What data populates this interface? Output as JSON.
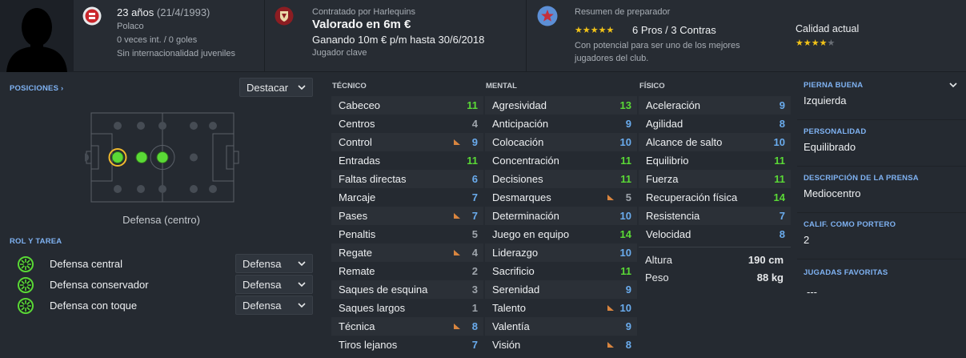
{
  "header": {
    "age_label": "23 años",
    "dob": "(21/4/1993)",
    "nationality": "Polaco",
    "caps": "0 veces int. / 0 goles",
    "youth_caps": "Sin internacionalidad juveniles",
    "contract_caption": "Contratado por Harlequins",
    "valuation": "Valorado en 6m €",
    "wage": "Ganando 10m € p/m hasta 30/6/2018",
    "squad_status": "Jugador clave",
    "coach_report_title": "Resumen de preparador",
    "pros_cons": "6 Pros / 3 Contras",
    "potential_text_line1": "Con potencial para ser uno de los mejores",
    "potential_text_line2": "jugadores del club.",
    "current_ability_label": "Calidad actual",
    "potential_stars": 5,
    "current_ability_stars": 4,
    "star_color": "#f2c318",
    "club_badge_color": "#c9262b",
    "icons": [
      "player-silhouette-icon",
      "nationality-badge-icon",
      "club-crest-icon",
      "coach-star-icon"
    ]
  },
  "positions": {
    "title": "POSICIONES ›",
    "highlight_dropdown": "Destacar",
    "position_name": "Defensa (centro)"
  },
  "roles": {
    "title": "ROL Y TAREA",
    "items": [
      {
        "name": "Defensa central",
        "duty": "Defensa"
      },
      {
        "name": "Defensa conservador",
        "duty": "Defensa"
      },
      {
        "name": "Defensa con toque",
        "duty": "Defensa"
      }
    ]
  },
  "technical": {
    "title": "TÉCNICO",
    "attributes": [
      {
        "name": "Cabeceo",
        "value": "11"
      },
      {
        "name": "Centros",
        "value": "4"
      },
      {
        "name": "Control",
        "value": "9",
        "flag": "down"
      },
      {
        "name": "Entradas",
        "value": "11"
      },
      {
        "name": "Faltas directas",
        "value": "6"
      },
      {
        "name": "Marcaje",
        "value": "7"
      },
      {
        "name": "Pases",
        "value": "7",
        "flag": "down"
      },
      {
        "name": "Penaltis",
        "value": "5"
      },
      {
        "name": "Regate",
        "value": "4",
        "flag": "down"
      },
      {
        "name": "Remate",
        "value": "2"
      },
      {
        "name": "Saques de esquina",
        "value": "3"
      },
      {
        "name": "Saques largos",
        "value": "1"
      },
      {
        "name": "Técnica",
        "value": "8",
        "flag": "down"
      },
      {
        "name": "Tiros lejanos",
        "value": "7"
      }
    ]
  },
  "mental": {
    "title": "MENTAL",
    "attributes": [
      {
        "name": "Agresividad",
        "value": "13"
      },
      {
        "name": "Anticipación",
        "value": "9"
      },
      {
        "name": "Colocación",
        "value": "10"
      },
      {
        "name": "Concentración",
        "value": "11"
      },
      {
        "name": "Decisiones",
        "value": "11"
      },
      {
        "name": "Desmarques",
        "value": "5",
        "flag": "down"
      },
      {
        "name": "Determinación",
        "value": "10"
      },
      {
        "name": "Juego en equipo",
        "value": "14"
      },
      {
        "name": "Liderazgo",
        "value": "10"
      },
      {
        "name": "Sacrificio",
        "value": "11"
      },
      {
        "name": "Serenidad",
        "value": "9"
      },
      {
        "name": "Talento",
        "value": "10",
        "flag": "down"
      },
      {
        "name": "Valentía",
        "value": "9"
      },
      {
        "name": "Visión",
        "value": "8",
        "flag": "down"
      }
    ]
  },
  "physical": {
    "title": "FÍSICO",
    "attributes": [
      {
        "name": "Aceleración",
        "value": "9"
      },
      {
        "name": "Agilidad",
        "value": "8"
      },
      {
        "name": "Alcance de salto",
        "value": "10"
      },
      {
        "name": "Equilibrio",
        "value": "11"
      },
      {
        "name": "Fuerza",
        "value": "11"
      },
      {
        "name": "Recuperación física",
        "value": "14"
      },
      {
        "name": "Resistencia",
        "value": "7"
      },
      {
        "name": "Velocidad",
        "value": "8"
      }
    ],
    "height_label": "Altura",
    "height_value": "190 cm",
    "weight_label": "Peso",
    "weight_value": "88 kg"
  },
  "info": {
    "preferred_foot_title": "PIERNA BUENA",
    "preferred_foot": "Izquierda",
    "personality_title": "PERSONALIDAD",
    "personality": "Equilibrado",
    "media_title": "DESCRIPCIÓN DE LA PRENSA",
    "media": "Mediocentro",
    "gk_rating_title": "CALIF. COMO PORTERO",
    "gk_rating": "2",
    "ppm_title": "JUGADAS FAVORITAS",
    "ppm": "---"
  },
  "colors": {
    "attr_green": "#5ad936",
    "attr_blue": "#6aacee",
    "attr_grey": "#9ea4ab",
    "flag_orange": "#d9853f",
    "section_blue": "#7fb2f2"
  }
}
